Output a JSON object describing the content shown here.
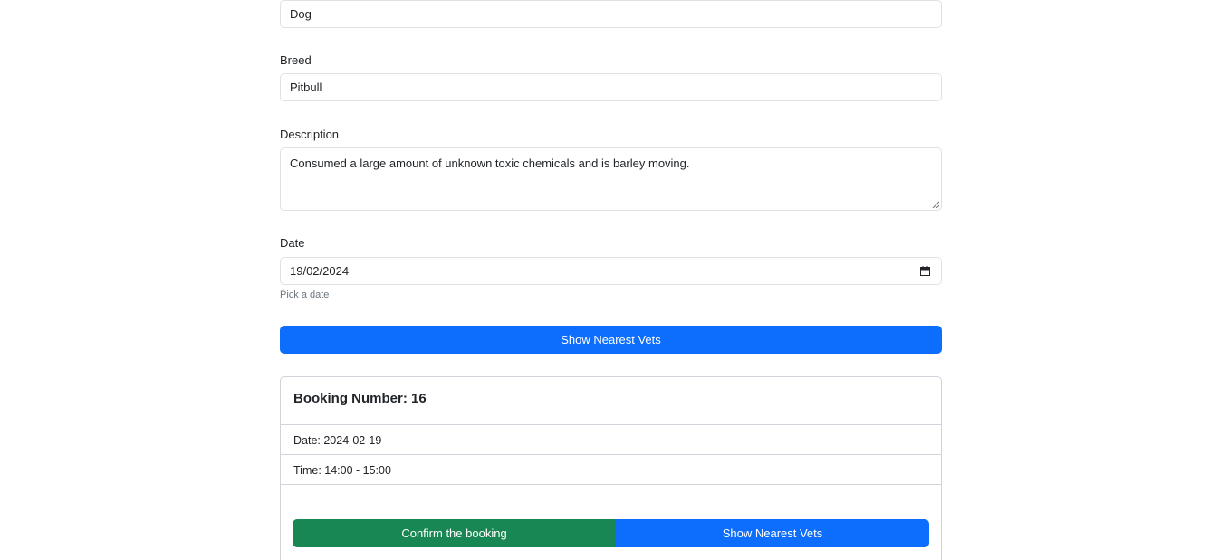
{
  "form": {
    "animal_type_value": "Dog",
    "breed_label": "Breed",
    "breed_value": "Pitbull",
    "description_label": "Description",
    "description_value": "Consumed a large amount of unknown toxic chemicals and is barley moving.",
    "date_label": "Date",
    "date_value": "19/02/2024",
    "date_help": "Pick a date",
    "show_vets_label": "Show Nearest Vets"
  },
  "booking": {
    "title": "Booking Number: 16",
    "date_text": "Date: 2024-02-19",
    "time_text": "Time: 14:00 - 15:00",
    "confirm_label": "Confirm the booking",
    "show_vets_label": "Show Nearest Vets"
  },
  "colors": {
    "primary": "#0d6efd",
    "success": "#198754",
    "border": "#dee2e6"
  }
}
